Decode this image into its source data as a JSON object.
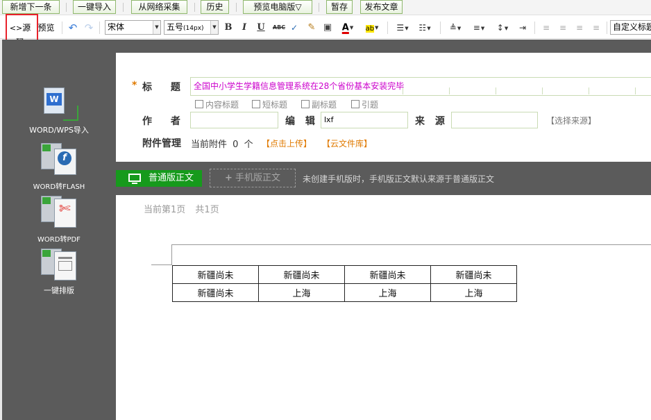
{
  "toolbar_top": {
    "buttons": [
      "新增下一条",
      "一键导入",
      "从网络采集",
      "历史",
      "预览电脑版▽",
      "暂存",
      "发布文章"
    ]
  },
  "toolbar_format": {
    "source_label": "源码",
    "preview_label": "预览",
    "font_family": "宋体",
    "font_size": "五号",
    "font_size_px": "(14px)",
    "custom_title": "自定义标题",
    "bold": "B",
    "italic": "I",
    "underline": "U",
    "strike": "ABC"
  },
  "left_tools": [
    {
      "label": "WORD/WPS导入",
      "icon": "word-import-icon"
    },
    {
      "label": "WORD转FLASH",
      "icon": "flash-convert-icon"
    },
    {
      "label": "WORD转PDF",
      "icon": "pdf-convert-icon"
    },
    {
      "label": "一键排版",
      "icon": "auto-format-icon"
    }
  ],
  "form": {
    "required_mark": "*",
    "title_label": "标 题",
    "title_value": "全国中小学生学籍信息管理系统在28个省份基本安装完毕",
    "options": [
      "内容标题",
      "短标题",
      "副标题",
      "引题"
    ],
    "author_label": "作 者",
    "author_value": "",
    "editor_label": "编 辑",
    "editor_value": "lxf",
    "source_label": "来 源",
    "source_value": "",
    "choose_source": "【选择来源】",
    "attach_label": "附件管理",
    "attach_current": "当前附件",
    "attach_count": "0",
    "attach_unit": "个",
    "upload_link": "【点击上传】",
    "cloud_link": "【云文件库】"
  },
  "mode_bar": {
    "normal_label": "普通版正文",
    "mobile_label": "手机版正文",
    "hint": "未创建手机版时，手机版正文默认来源于普通版正文"
  },
  "document": {
    "page_info": "当前第1页",
    "page_total": "共1页",
    "table": [
      [
        "新疆尚未",
        "新疆尚未",
        "新疆尚未",
        "新疆尚未"
      ],
      [
        "新疆尚未",
        "上海",
        "上海",
        "上海"
      ]
    ]
  },
  "colors": {
    "highlight_box": "#e8212a",
    "accent_green": "#169a1c",
    "title_text": "#cc00cc",
    "link_orange": "#e07a00"
  }
}
